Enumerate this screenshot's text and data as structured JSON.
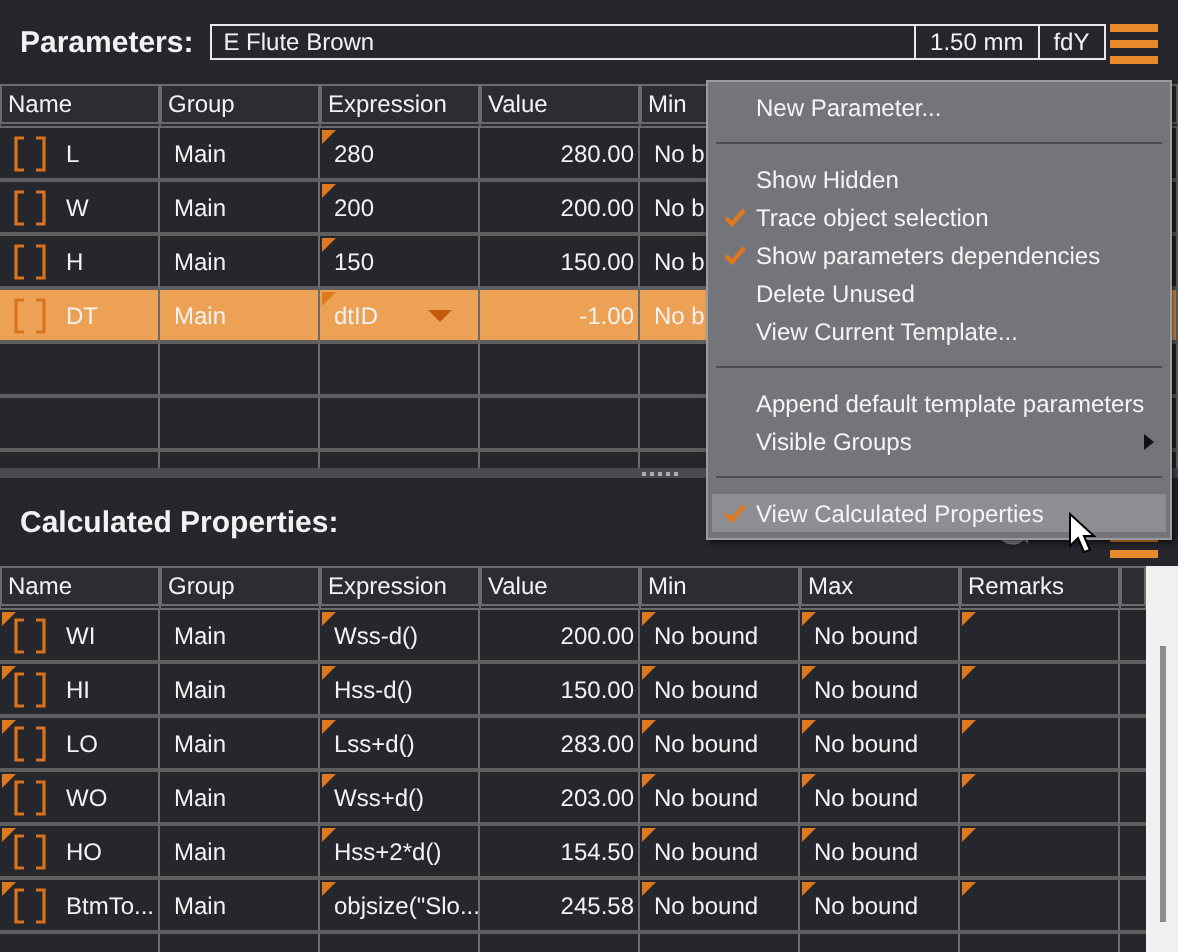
{
  "toolbar": {
    "title": "Parameters:",
    "material": "E Flute Brown",
    "thickness": "1.50 mm",
    "flute": "fdY"
  },
  "parameters": {
    "columns": [
      {
        "label": "Name",
        "flagged": false
      },
      {
        "label": "Group",
        "flagged": false
      },
      {
        "label": "Expression",
        "flagged": true
      },
      {
        "label": "Value",
        "flagged": false
      },
      {
        "label": "Min",
        "flagged": false
      }
    ],
    "rows": [
      {
        "cells": [
          "L",
          "Main",
          "280",
          "280.00",
          "No b"
        ],
        "selected": false
      },
      {
        "cells": [
          "W",
          "Main",
          "200",
          "200.00",
          "No b"
        ],
        "selected": false
      },
      {
        "cells": [
          "H",
          "Main",
          "150",
          "150.00",
          "No b"
        ],
        "selected": false
      },
      {
        "cells": [
          "DT",
          "Main",
          "dtID",
          "-1.00",
          "No b"
        ],
        "selected": true
      }
    ]
  },
  "calculated": {
    "title": "Calculated Properties:",
    "columns": [
      {
        "label": "Name",
        "flagged": true
      },
      {
        "label": "Group",
        "flagged": false
      },
      {
        "label": "Expression",
        "flagged": true
      },
      {
        "label": "Value",
        "flagged": false
      },
      {
        "label": "Min",
        "flagged": true
      },
      {
        "label": "Max",
        "flagged": true
      },
      {
        "label": "Remarks",
        "flagged": true
      }
    ],
    "rows": [
      {
        "cells": [
          "WI",
          "Main",
          "Wss-d()",
          "200.00",
          "No bound",
          "No bound",
          ""
        ],
        "selected": false
      },
      {
        "cells": [
          "HI",
          "Main",
          "Hss-d()",
          "150.00",
          "No bound",
          "No bound",
          ""
        ],
        "selected": false
      },
      {
        "cells": [
          "LO",
          "Main",
          "Lss+d()",
          "283.00",
          "No bound",
          "No bound",
          ""
        ],
        "selected": false
      },
      {
        "cells": [
          "WO",
          "Main",
          "Wss+d()",
          "203.00",
          "No bound",
          "No bound",
          ""
        ],
        "selected": false
      },
      {
        "cells": [
          "HO",
          "Main",
          "Hss+2*d()",
          "154.50",
          "No bound",
          "No bound",
          ""
        ],
        "selected": false
      },
      {
        "cells": [
          "BtmTo...",
          "Main",
          "objsize(\"Slo...",
          "245.58",
          "No bound",
          "No bound",
          ""
        ],
        "selected": false
      }
    ]
  },
  "context_menu": {
    "items": [
      {
        "kind": "item",
        "label": "New Parameter...",
        "checked": false,
        "submenu": false,
        "selected": false
      },
      {
        "kind": "separator"
      },
      {
        "kind": "item",
        "label": "Show Hidden",
        "checked": false,
        "submenu": false,
        "selected": false
      },
      {
        "kind": "item",
        "label": "Trace object selection",
        "checked": true,
        "submenu": false,
        "selected": false
      },
      {
        "kind": "item",
        "label": "Show parameters dependencies",
        "checked": true,
        "submenu": false,
        "selected": false
      },
      {
        "kind": "item",
        "label": "Delete Unused",
        "checked": false,
        "submenu": false,
        "selected": false
      },
      {
        "kind": "item",
        "label": "View Current Template...",
        "checked": false,
        "submenu": false,
        "selected": false
      },
      {
        "kind": "separator"
      },
      {
        "kind": "item",
        "label": "Append default template parameters",
        "checked": false,
        "submenu": false,
        "selected": false
      },
      {
        "kind": "item",
        "label": "Visible Groups",
        "checked": false,
        "submenu": true,
        "selected": false
      },
      {
        "kind": "separator"
      },
      {
        "kind": "item",
        "label": "View Calculated Properties",
        "checked": true,
        "submenu": false,
        "selected": true
      }
    ]
  }
}
